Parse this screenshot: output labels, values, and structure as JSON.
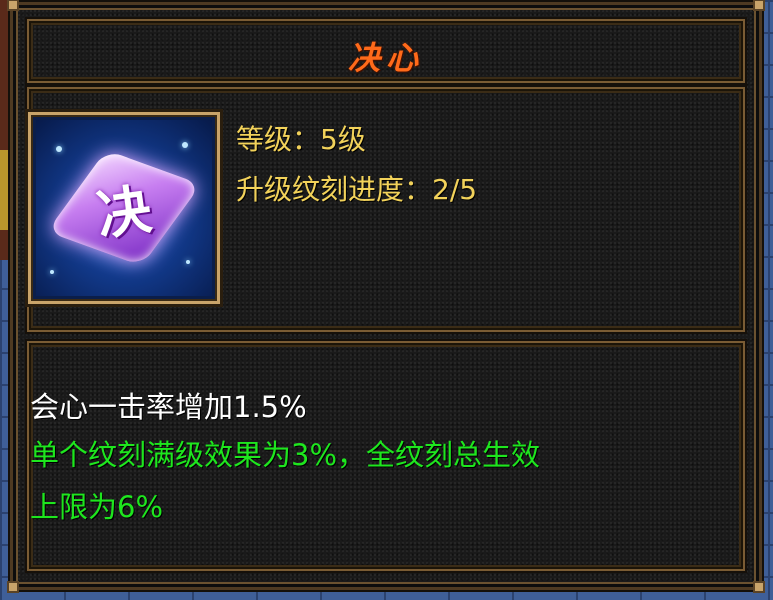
{
  "skill": {
    "title": "决心",
    "icon_name": "jue-rune-gem-icon",
    "icon_char": "决",
    "level_line": "等级：5级",
    "progress_line": "升级纹刻进度：2/5",
    "level": 5,
    "engrave_progress": {
      "current": 2,
      "max": 5
    }
  },
  "description": {
    "effect": "会心一击率增加1.5%",
    "note_line1": "单个纹刻满级效果为3%，全纹刻总生效",
    "note_line2": "上限为6%"
  },
  "colors": {
    "title": "#ff6a1a",
    "stats": "#f2d25a",
    "effect": "#ffffff",
    "note": "#1ee61e",
    "frame_gold": "#c9a46a"
  }
}
